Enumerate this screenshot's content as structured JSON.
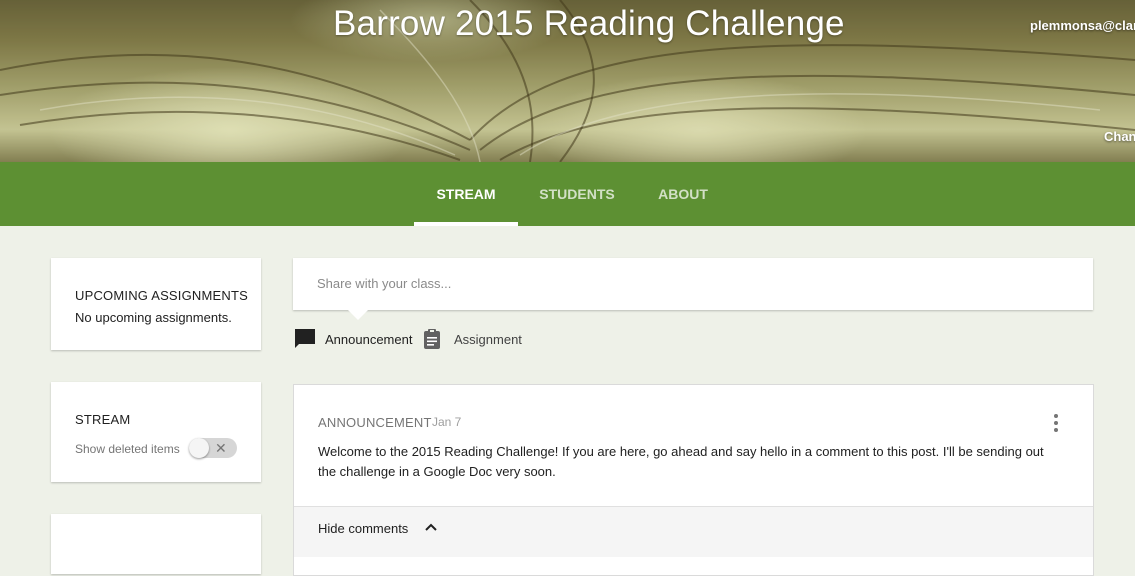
{
  "header": {
    "class_title": "Barrow 2015 Reading Challenge",
    "account_email": "plemmonsa@clarkecounty...",
    "change_theme": "Chan"
  },
  "tabs": [
    {
      "label": "STREAM",
      "active": true
    },
    {
      "label": "STUDENTS",
      "active": false
    },
    {
      "label": "ABOUT",
      "active": false
    }
  ],
  "sidebar": {
    "upcoming": {
      "title": "UPCOMING ASSIGNMENTS",
      "text": "No upcoming assignments."
    },
    "stream": {
      "title": "STREAM",
      "toggle_label": "Show deleted items",
      "toggle_on": false
    }
  },
  "share": {
    "placeholder": "Share with your class...",
    "value": ""
  },
  "compose": {
    "announcement_label": "Announcement",
    "assignment_label": "Assignment",
    "announcement_icon": "chat-bubble-icon",
    "assignment_icon": "clipboard-icon"
  },
  "post": {
    "type": "ANNOUNCEMENT",
    "date": "Jan 7",
    "body": "Welcome to the 2015 Reading Challenge! If you are here, go ahead and say hello in a comment to this post. I'll be sending out the challenge in a Google Doc very soon.",
    "hide_comments_label": "Hide comments"
  },
  "colors": {
    "tab_bar": "#5d9033",
    "page_background": "#eef1e8",
    "card": "#ffffff"
  }
}
